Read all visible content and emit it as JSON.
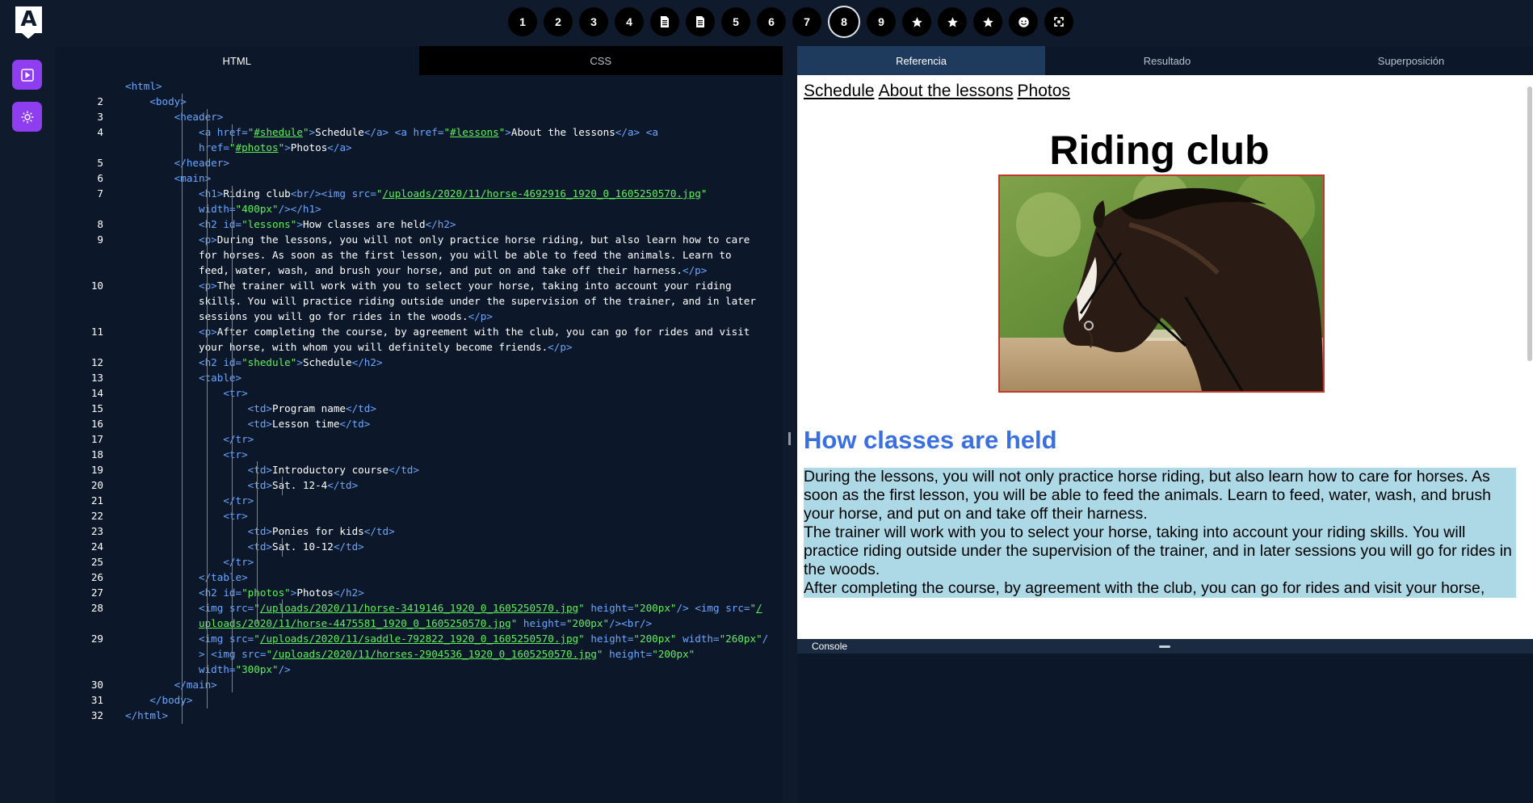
{
  "app": {
    "logo_letter": "A"
  },
  "steps": [
    {
      "label": "1",
      "kind": "num"
    },
    {
      "label": "2",
      "kind": "num"
    },
    {
      "label": "3",
      "kind": "num"
    },
    {
      "label": "4",
      "kind": "num"
    },
    {
      "label": "",
      "kind": "doc-icon"
    },
    {
      "label": "",
      "kind": "doc-icon"
    },
    {
      "label": "5",
      "kind": "num"
    },
    {
      "label": "6",
      "kind": "num"
    },
    {
      "label": "7",
      "kind": "num"
    },
    {
      "label": "8",
      "kind": "num",
      "active": true
    },
    {
      "label": "9",
      "kind": "num"
    },
    {
      "label": "",
      "kind": "star-icon"
    },
    {
      "label": "",
      "kind": "star-icon"
    },
    {
      "label": "",
      "kind": "star-icon"
    },
    {
      "label": "",
      "kind": "smiley-icon"
    },
    {
      "label": "",
      "kind": "expand-icon"
    }
  ],
  "editor": {
    "tabs": [
      {
        "label": "HTML",
        "active": true
      },
      {
        "label": "CSS",
        "active": false
      }
    ],
    "line_numbers": [
      "",
      "2",
      "3",
      "4",
      "",
      "5",
      "6",
      "7",
      "",
      "8",
      "9",
      "",
      "",
      "10",
      "",
      "",
      "11",
      "",
      "12",
      "13",
      "14",
      "15",
      "16",
      "17",
      "18",
      "19",
      "20",
      "21",
      "22",
      "23",
      "24",
      "25",
      "26",
      "27",
      "28",
      "",
      "29",
      "",
      "",
      "30",
      "31",
      "32"
    ]
  },
  "preview": {
    "tabs": [
      {
        "label": "Referencia",
        "active": true
      },
      {
        "label": "Resultado",
        "active": false
      },
      {
        "label": "Superposición",
        "active": false
      }
    ],
    "nav": [
      "Schedule",
      "About the lessons",
      "Photos"
    ],
    "title": "Riding club",
    "section_heading": "How classes are held",
    "paragraphs": [
      "During the lessons, you will not only practice horse riding, but also learn how to care for horses. As soon as the first lesson, you will be able to feed the animals. Learn to feed, water, wash, and brush your horse, and put on and take off their harness.",
      "The trainer will work with you to select your horse, taking into account your riding skills. You will practice riding outside under the supervision of the trainer, and in later sessions you will go for rides in the woods.",
      "After completing the course, by agreement with the club, you can go for rides and visit your horse,"
    ],
    "console_label": "Console"
  },
  "colors": {
    "accent": "#8f3df0",
    "heading_blue": "#3a6fe0",
    "para_bg": "#add8e6"
  }
}
